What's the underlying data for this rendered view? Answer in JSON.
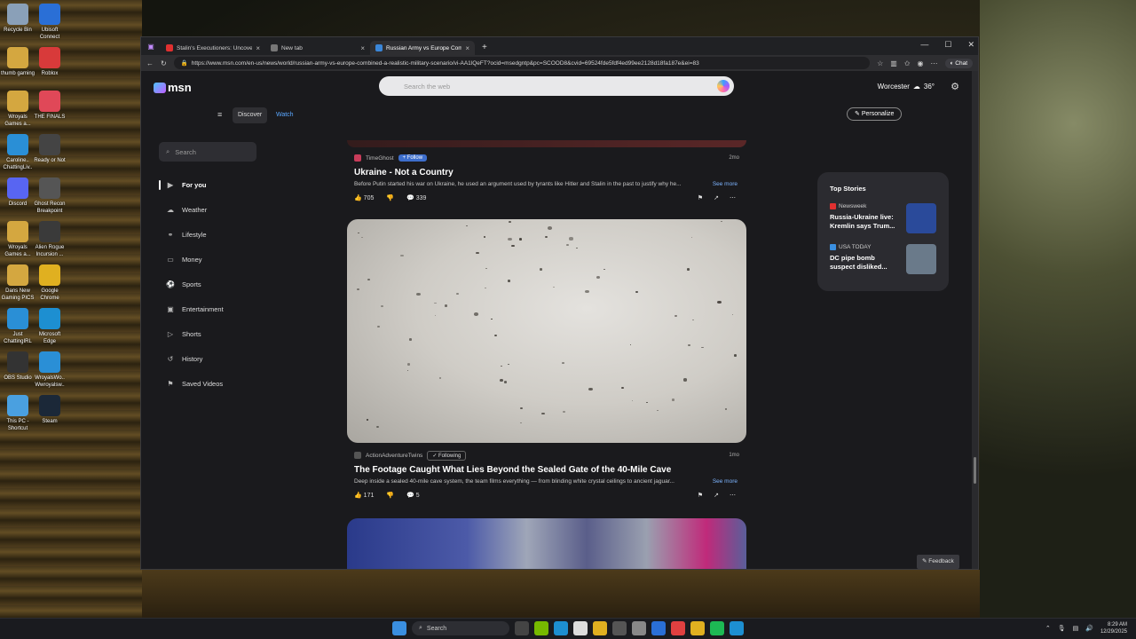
{
  "desktop": {
    "icons": [
      {
        "label": "Recycle Bin",
        "color": "#8aa0b8"
      },
      {
        "label": "Ubisoft Connect",
        "color": "#2a6fd6"
      },
      {
        "label": "thumb gaming",
        "color": "#d4a740"
      },
      {
        "label": "Roblox",
        "color": "#d83a3a"
      },
      {
        "label": "Wroyals Games a...",
        "color": "#d4a740"
      },
      {
        "label": "THE FINALS",
        "color": "#e04858"
      },
      {
        "label": "Caroline.. ChattingLiv..",
        "color": "#2a8fd6"
      },
      {
        "label": "Ready or Not",
        "color": "#444444"
      },
      {
        "label": "Discord",
        "color": "#5865f2"
      },
      {
        "label": "Ghost Recon Breakpoint",
        "color": "#555555"
      },
      {
        "label": "Wroyals Games a...",
        "color": "#d4a740"
      },
      {
        "label": "Alien Rogue Incursion ...",
        "color": "#3a3a3a"
      },
      {
        "label": "Dans New Gaming PICS",
        "color": "#d4a740"
      },
      {
        "label": "Google Chrome",
        "color": "#e0b020"
      },
      {
        "label": "Just ChattingIRL",
        "color": "#2a8fd6"
      },
      {
        "label": "Microsoft Edge",
        "color": "#1d8fd1"
      },
      {
        "label": "OBS Studio",
        "color": "#333333"
      },
      {
        "label": "WroyalsWo.. Wwroyalsw..",
        "color": "#2a8fd6"
      },
      {
        "label": "This PC - Shortcut",
        "color": "#4aa0e0"
      },
      {
        "label": "Steam",
        "color": "#1b2838"
      }
    ]
  },
  "browser": {
    "tabs": [
      {
        "label": "Stalin's Executioners: Uncovering S",
        "fav": "#e03030",
        "active": false
      },
      {
        "label": "New tab",
        "fav": "#777777",
        "active": false
      },
      {
        "label": "Russian Army vs Europe Comb",
        "fav": "#3a86d8",
        "active": true
      }
    ],
    "new_tab": "+",
    "window_controls": {
      "minimize": "—",
      "maximize": "☐",
      "close": "✕"
    },
    "url": "https://www.msn.com/en-us/news/world/russian-army-vs-europe-combined-a-realistic-military-scenario/vi-AA1lQeFT?ocid=msedgntp&pc=SCOOD8&cvid=69524fde5fdf4ed99ee2128d18fa187e&ei=83",
    "chat_label": "Chat"
  },
  "msn": {
    "logo": "msn",
    "search_placeholder": "Search the web",
    "location": "Worcester",
    "temperature": "36°",
    "nav": {
      "discover": "Discover",
      "watch": "Watch",
      "personalize": "Personalize"
    },
    "sidebar": {
      "search_placeholder": "Search",
      "items": [
        {
          "label": "For you",
          "icon": "▶"
        },
        {
          "label": "Weather",
          "icon": "☁"
        },
        {
          "label": "Lifestyle",
          "icon": "⚭"
        },
        {
          "label": "Money",
          "icon": "▭"
        },
        {
          "label": "Sports",
          "icon": "⚽"
        },
        {
          "label": "Entertainment",
          "icon": "▣"
        },
        {
          "label": "Shorts",
          "icon": "▷"
        },
        {
          "label": "History",
          "icon": "↺"
        },
        {
          "label": "Saved Videos",
          "icon": "⚑"
        }
      ]
    },
    "feed": [
      {
        "source": "TimeGhost",
        "follow": "Follow",
        "age": "2mo",
        "headline": "Ukraine - Not a Country",
        "snippet": "Before Putin started his war on Ukraine, he used an argument used by tyrants like Hitler and Stalin in the past to justify why he...",
        "see_more": "See more",
        "likes": "705",
        "comments": "339"
      },
      {
        "source": "ActionAdventureTwins",
        "follow": "Following",
        "age": "1mo",
        "headline": "The Footage Caught What Lies Beyond the Sealed Gate of the 40-Mile Cave",
        "snippet": "Deep inside a sealed 40-mile cave system, the team films everything — from blinding white crystal ceilings to ancient jaguar...",
        "see_more": "See more",
        "likes": "171",
        "comments": "5"
      }
    ],
    "top_stories": {
      "title": "Top Stories",
      "items": [
        {
          "source": "Newsweek",
          "headline": "Russia-Ukraine live: Kremlin says Trum...",
          "src_color": "#e03030",
          "thumb": "#2a4a9a"
        },
        {
          "source": "USA TODAY",
          "headline": "DC pipe bomb suspect disliked...",
          "src_color": "#3a8fe0",
          "thumb": "#6a7a8a"
        }
      ]
    },
    "feedback": "Feedback"
  },
  "taskbar": {
    "search_placeholder": "Search",
    "time": "8:29 AM",
    "date": "12/29/2025"
  }
}
